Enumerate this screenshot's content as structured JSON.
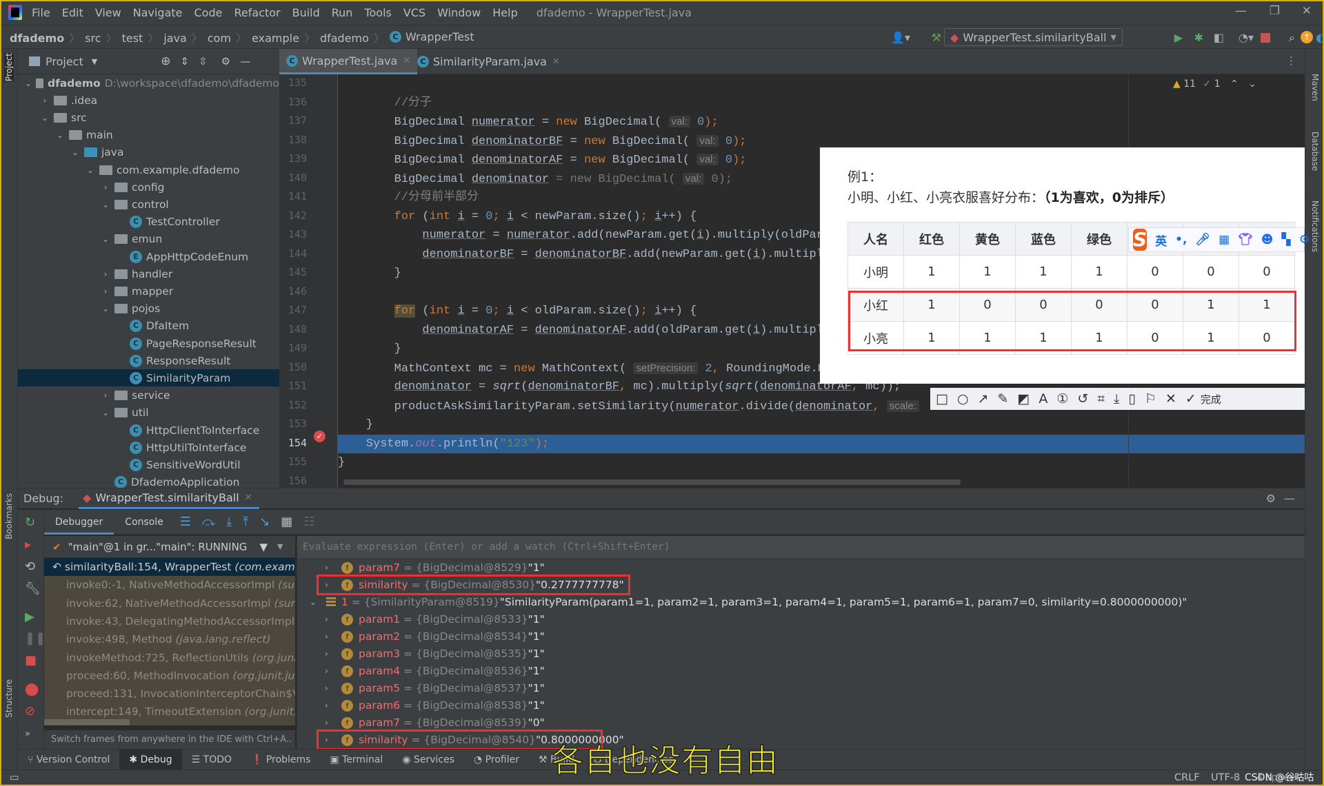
{
  "window": {
    "title": "dfademo - WrapperTest.java",
    "menu": [
      "File",
      "Edit",
      "View",
      "Navigate",
      "Code",
      "Refactor",
      "Build",
      "Run",
      "Tools",
      "VCS",
      "Window",
      "Help"
    ]
  },
  "navbar": {
    "crumbs": [
      "dfademo",
      "src",
      "test",
      "java",
      "com",
      "example",
      "dfademo"
    ],
    "file": "WrapperTest",
    "run_config": "WrapperTest.similarityBall"
  },
  "project": {
    "title": "Project",
    "tree": [
      {
        "d": 0,
        "open": true,
        "type": "module",
        "label": "dfademo",
        "hint": "D:\\workspace\\dfademo\\dfademo"
      },
      {
        "d": 1,
        "open": false,
        "type": "folder",
        "label": ".idea"
      },
      {
        "d": 1,
        "open": true,
        "type": "folder",
        "label": "src"
      },
      {
        "d": 2,
        "open": true,
        "type": "folder",
        "label": "main"
      },
      {
        "d": 3,
        "open": true,
        "type": "srcfolder",
        "label": "java"
      },
      {
        "d": 4,
        "open": true,
        "type": "package",
        "label": "com.example.dfademo"
      },
      {
        "d": 5,
        "open": false,
        "type": "package",
        "label": "config"
      },
      {
        "d": 5,
        "open": true,
        "type": "package",
        "label": "control"
      },
      {
        "d": 6,
        "type": "class",
        "label": "TestController"
      },
      {
        "d": 5,
        "open": true,
        "type": "package",
        "label": "emun"
      },
      {
        "d": 6,
        "type": "enum",
        "label": "AppHttpCodeEnum"
      },
      {
        "d": 5,
        "open": false,
        "type": "package",
        "label": "handler"
      },
      {
        "d": 5,
        "open": false,
        "type": "package",
        "label": "mapper"
      },
      {
        "d": 5,
        "open": true,
        "type": "package",
        "label": "pojos"
      },
      {
        "d": 6,
        "type": "class",
        "label": "DfaItem"
      },
      {
        "d": 6,
        "type": "class",
        "label": "PageResponseResult"
      },
      {
        "d": 6,
        "type": "class",
        "label": "ResponseResult"
      },
      {
        "d": 6,
        "type": "class",
        "label": "SimilarityParam",
        "selected": true
      },
      {
        "d": 5,
        "open": false,
        "type": "package",
        "label": "service"
      },
      {
        "d": 5,
        "open": true,
        "type": "package",
        "label": "util"
      },
      {
        "d": 6,
        "type": "class",
        "label": "HttpClientToInterface"
      },
      {
        "d": 6,
        "type": "class",
        "label": "HttpUtilToInterface"
      },
      {
        "d": 6,
        "type": "class",
        "label": "SensitiveWordUtil"
      },
      {
        "d": 5,
        "type": "class",
        "label": "DfademoApplication"
      }
    ]
  },
  "editor": {
    "tabs": [
      "WrapperTest.java",
      "SimilarityParam.java"
    ],
    "active_tab": 0,
    "inspections": {
      "warnings": "11",
      "ok": "1"
    },
    "lines": [
      {
        "n": "135",
        "s": []
      },
      {
        "n": "136",
        "s": [
          {
            "t": "        //分子",
            "c": "cm"
          }
        ]
      },
      {
        "n": "137",
        "s": [
          {
            "t": "        BigDecimal "
          },
          {
            "t": "numerator",
            "c": "u"
          },
          {
            "t": " = "
          },
          {
            "t": "new",
            "c": "kw"
          },
          {
            "t": " BigDecimal( "
          },
          {
            "t": "val:",
            "c": "hint"
          },
          {
            "t": " 0",
            "c": "num"
          },
          {
            "t": ");",
            "c": "kw"
          }
        ]
      },
      {
        "n": "138",
        "s": [
          {
            "t": "        BigDecimal "
          },
          {
            "t": "denominatorBF",
            "c": "u"
          },
          {
            "t": " = "
          },
          {
            "t": "new",
            "c": "kw"
          },
          {
            "t": " BigDecimal( "
          },
          {
            "t": "val:",
            "c": "hint"
          },
          {
            "t": " 0",
            "c": "num"
          },
          {
            "t": ");",
            "c": "kw"
          }
        ]
      },
      {
        "n": "139",
        "s": [
          {
            "t": "        BigDecimal "
          },
          {
            "t": "denominatorAF",
            "c": "u"
          },
          {
            "t": " = "
          },
          {
            "t": "new",
            "c": "kw"
          },
          {
            "t": " BigDecimal( "
          },
          {
            "t": "val:",
            "c": "hint"
          },
          {
            "t": " 0",
            "c": "num"
          },
          {
            "t": ");",
            "c": "kw"
          }
        ]
      },
      {
        "n": "140",
        "s": [
          {
            "t": "        BigDecimal "
          },
          {
            "t": "denominator",
            "c": "u"
          },
          {
            "t": " = new BigDecimal( ",
            "c": "dimc"
          },
          {
            "t": "val:",
            "c": "hint"
          },
          {
            "t": " 0);",
            "c": "dimc"
          }
        ]
      },
      {
        "n": "141",
        "s": [
          {
            "t": "        //分母前半部分",
            "c": "cm"
          }
        ]
      },
      {
        "n": "142",
        "s": [
          {
            "t": "        "
          },
          {
            "t": "for",
            "c": "kw"
          },
          {
            "t": " ("
          },
          {
            "t": "int",
            "c": "kw"
          },
          {
            "t": " "
          },
          {
            "t": "i",
            "c": "u"
          },
          {
            "t": " = "
          },
          {
            "t": "0",
            "c": "num"
          },
          {
            "t": "; ",
            "c": "kw"
          },
          {
            "t": "i",
            "c": "u"
          },
          {
            "t": " < newParam.size()"
          },
          {
            "t": "; ",
            "c": "kw"
          },
          {
            "t": "i",
            "c": "u"
          },
          {
            "t": "++) {"
          }
        ]
      },
      {
        "n": "143",
        "s": [
          {
            "t": "            "
          },
          {
            "t": "numerator",
            "c": "u"
          },
          {
            "t": " = "
          },
          {
            "t": "numerator",
            "c": "u"
          },
          {
            "t": ".add(newParam.get("
          },
          {
            "t": "i",
            "c": "u"
          },
          {
            "t": ").multiply(oldParam.get("
          }
        ]
      },
      {
        "n": "144",
        "s": [
          {
            "t": "            "
          },
          {
            "t": "denominatorBF",
            "c": "u"
          },
          {
            "t": " = "
          },
          {
            "t": "denominatorBF",
            "c": "u"
          },
          {
            "t": ".add(newParam.get("
          },
          {
            "t": "i",
            "c": "u"
          },
          {
            "t": ").multiply(newParam"
          }
        ]
      },
      {
        "n": "145",
        "s": [
          {
            "t": "        }"
          }
        ]
      },
      {
        "n": "146",
        "s": []
      },
      {
        "n": "147",
        "s": [
          {
            "t": "        "
          },
          {
            "t": "for",
            "c": "kw forhl"
          },
          {
            "t": " ("
          },
          {
            "t": "int",
            "c": "kw"
          },
          {
            "t": " "
          },
          {
            "t": "i",
            "c": "u"
          },
          {
            "t": " = "
          },
          {
            "t": "0",
            "c": "num"
          },
          {
            "t": "; ",
            "c": "kw"
          },
          {
            "t": "i",
            "c": "u"
          },
          {
            "t": " < oldParam.size()"
          },
          {
            "t": "; ",
            "c": "kw"
          },
          {
            "t": "i",
            "c": "u"
          },
          {
            "t": "++) {"
          }
        ]
      },
      {
        "n": "148",
        "s": [
          {
            "t": "            "
          },
          {
            "t": "denominatorAF",
            "c": "u"
          },
          {
            "t": " = "
          },
          {
            "t": "denominatorAF",
            "c": "u"
          },
          {
            "t": ".add(oldParam.get("
          },
          {
            "t": "i",
            "c": "u"
          },
          {
            "t": ").multiply(oldParam"
          }
        ]
      },
      {
        "n": "149",
        "s": [
          {
            "t": "        }"
          }
        ]
      },
      {
        "n": "150",
        "s": [
          {
            "t": "        MathContext mc = "
          },
          {
            "t": "new",
            "c": "kw"
          },
          {
            "t": " MathContext( "
          },
          {
            "t": "setPrecision:",
            "c": "hint"
          },
          {
            "t": " 2",
            "c": "num"
          },
          {
            "t": ", ",
            "c": "kw"
          },
          {
            "t": "RoundingMode.HALF_UP);"
          }
        ]
      },
      {
        "n": "151",
        "s": [
          {
            "t": "        "
          },
          {
            "t": "denominator",
            "c": "u"
          },
          {
            "t": " = "
          },
          {
            "t": "sqrt",
            "c": "it"
          },
          {
            "t": "("
          },
          {
            "t": "denominatorBF",
            "c": "u"
          },
          {
            "t": ", ",
            "c": "kw"
          },
          {
            "t": "mc).multiply("
          },
          {
            "t": "sqrt",
            "c": "it"
          },
          {
            "t": "("
          },
          {
            "t": "denominatorAF",
            "c": "u"
          },
          {
            "t": ", ",
            "c": "kw"
          },
          {
            "t": "mc));"
          }
        ]
      },
      {
        "n": "152",
        "s": [
          {
            "t": "        productAskSimilarityParam.setSimilarity("
          },
          {
            "t": "numerator",
            "c": "u"
          },
          {
            "t": ".divide("
          },
          {
            "t": "denominator",
            "c": "u"
          },
          {
            "t": ", ",
            "c": "kw"
          },
          {
            "t": "scale:",
            "c": "hint"
          }
        ]
      },
      {
        "n": "153",
        "s": [
          {
            "t": "    }"
          }
        ]
      },
      {
        "n": "154",
        "s": [
          {
            "t": "    System."
          },
          {
            "t": "out",
            "c": "fld"
          },
          {
            "t": ".println("
          },
          {
            "t": "\"123\"",
            "c": "str"
          },
          {
            "t": ");",
            "c": "kw"
          }
        ],
        "exec": true
      },
      {
        "n": "155",
        "s": [
          {
            "t": "}"
          }
        ]
      },
      {
        "n": "156",
        "s": []
      }
    ]
  },
  "popup": {
    "line1": "例1：",
    "line2_plain": "小明、小红、小亮衣服喜好分布：",
    "line2_bold": "（1为喜欢，0为排斥）",
    "table": {
      "headers": [
        "人名",
        "红色",
        "黄色",
        "蓝色",
        "绿色",
        "",
        "",
        ""
      ],
      "rows": [
        [
          "小明",
          "1",
          "1",
          "1",
          "1",
          "0",
          "0",
          "0"
        ],
        [
          "小红",
          "1",
          "0",
          "0",
          "0",
          "0",
          "1",
          "1"
        ],
        [
          "小亮",
          "1",
          "1",
          "1",
          "1",
          "0",
          "1",
          "0"
        ]
      ]
    },
    "ime": {
      "lang": "英",
      "punct": "•,"
    },
    "toolbar_done": "完成"
  },
  "debug": {
    "label": "Debug:",
    "session": "WrapperTest.similarityBall",
    "tabs": [
      "Debugger",
      "Console"
    ],
    "thread": "\"main\"@1 in gr...\"main\": RUNNING",
    "frames": [
      {
        "m": "similarityBall:154, WrapperTest ",
        "p": "(com.example"
      },
      {
        "m": "invoke0:-1, NativeMethodAccessorImpl ",
        "p": "(sun.r"
      },
      {
        "m": "invoke:62, NativeMethodAccessorImpl ",
        "p": "(sun.re"
      },
      {
        "m": "invoke:43, DelegatingMethodAccessorImpl ",
        "p": "(s"
      },
      {
        "m": "invoke:498, Method ",
        "p": "(java.lang.reflect)"
      },
      {
        "m": "invokeMethod:725, ReflectionUtils ",
        "p": "(org.junit."
      },
      {
        "m": "proceed:60, MethodInvocation ",
        "p": "(org.junit.jupi"
      },
      {
        "m": "proceed:131, InvocationInterceptorChain$Val",
        "p": ""
      },
      {
        "m": "intercept:149, TimeoutExtension ",
        "p": "(org.junit.ju"
      }
    ],
    "switch_hint": "Switch frames from anywhere in the IDE with Ctrl+A..",
    "eval_placeholder": "Evaluate expression (Enter) or add a watch (Ctrl+Shift+Enter)",
    "variables": [
      {
        "ind": 1,
        "name": "param7",
        "type": "{BigDecimal@8529}",
        "val": "\"1\""
      },
      {
        "ind": 1,
        "name": "similarity",
        "type": "{BigDecimal@8530}",
        "val": "\"0.2777777778\"",
        "boxed": true
      },
      {
        "ind": 0,
        "open": true,
        "obj": true,
        "name": "1",
        "type": "{SimilarityParam@8519}",
        "val": "\"SimilarityParam(param1=1, param2=1, param3=1, param4=1, param5=1, param6=1, param7=0, similarity=0.8000000000)\""
      },
      {
        "ind": 1,
        "name": "param1",
        "type": "{BigDecimal@8533}",
        "val": "\"1\""
      },
      {
        "ind": 1,
        "name": "param2",
        "type": "{BigDecimal@8534}",
        "val": "\"1\""
      },
      {
        "ind": 1,
        "name": "param3",
        "type": "{BigDecimal@8535}",
        "val": "\"1\""
      },
      {
        "ind": 1,
        "name": "param4",
        "type": "{BigDecimal@8536}",
        "val": "\"1\""
      },
      {
        "ind": 1,
        "name": "param5",
        "type": "{BigDecimal@8537}",
        "val": "\"1\""
      },
      {
        "ind": 1,
        "name": "param6",
        "type": "{BigDecimal@8538}",
        "val": "\"1\""
      },
      {
        "ind": 1,
        "name": "param7",
        "type": "{BigDecimal@8539}",
        "val": "\"0\""
      },
      {
        "ind": 1,
        "name": "similarity",
        "type": "{BigDecimal@8540}",
        "val": "\"0.8000000000\"",
        "boxed": true
      }
    ]
  },
  "bottom_tools": [
    "Version Control",
    "Debug",
    "TODO",
    "Problems",
    "Terminal",
    "Services",
    "Profiler",
    "Build",
    "Dependencies"
  ],
  "status": {
    "crlf": "CRLF",
    "encoding": "UTF-8",
    "indent": "4 spaces",
    "watermark": "CSDN @谷咕咕"
  },
  "side_labels": {
    "project": "Project",
    "bookmarks": "Bookmarks",
    "structure": "Structure",
    "maven": "Maven",
    "database": "Database",
    "notifications": "Notifications"
  },
  "subtitle": "各自也没有自由",
  "colors": {
    "accent": "#4a88c7",
    "exec_line": "#2d5f96",
    "highlight_box": "#f03030",
    "subtitle": "#f5f029"
  }
}
